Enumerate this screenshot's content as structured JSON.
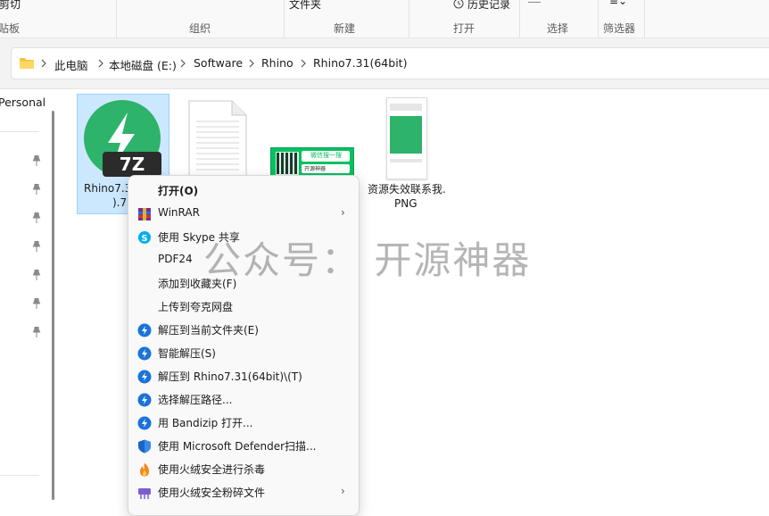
{
  "ribbon": {
    "cut_label": "剪切",
    "paste_label": "贴板",
    "new_folder_label": "文件夹",
    "history_label": "历史记录",
    "groups": {
      "organize": "组织",
      "new": "新建",
      "open": "打开",
      "select": "选择",
      "filter": "筛选器"
    }
  },
  "address": {
    "crumbs": [
      "此电脑",
      "本地磁盘 (E:)",
      "Software",
      "Rhino",
      "Rhino7.31(64bit)"
    ]
  },
  "nav": {
    "personal_label": "Personal"
  },
  "files": [
    {
      "name_line1": "Rhino7.3",
      "name_line2": ").7",
      "type": "7z-archive",
      "badge": "7Z",
      "selected": true
    },
    {
      "name": "",
      "type": "text-document"
    },
    {
      "name": "",
      "type": "wechat-qr-banner",
      "banner_text": "微信搜一搜",
      "banner_sub": "开源神器"
    },
    {
      "name_line1": "资源失效联系我.",
      "name_line2": "PNG",
      "type": "png-image"
    }
  ],
  "context_menu": {
    "items": [
      {
        "label": "打开(O)",
        "bold": true,
        "icon": "none",
        "submenu": false
      },
      {
        "label": "WinRAR",
        "icon": "winrar-icon",
        "submenu": true
      },
      {
        "label": "使用 Skype 共享",
        "icon": "skype-icon",
        "submenu": false
      },
      {
        "label": "PDF24",
        "icon": "none",
        "submenu": false
      },
      {
        "label": "添加到收藏夹(F)",
        "icon": "none",
        "submenu": false
      },
      {
        "label": "上传到夸克网盘",
        "icon": "none",
        "submenu": false
      },
      {
        "label": "解压到当前文件夹(E)",
        "icon": "bandizip-icon",
        "submenu": false
      },
      {
        "label": "智能解压(S)",
        "icon": "bandizip-icon",
        "submenu": false
      },
      {
        "label": "解压到 Rhino7.31(64bit)\\(T)",
        "icon": "bandizip-icon",
        "submenu": false
      },
      {
        "label": "选择解压路径...",
        "icon": "bandizip-icon",
        "submenu": false
      },
      {
        "label": "用 Bandizip 打开...",
        "icon": "bandizip-icon",
        "submenu": false
      },
      {
        "label": "使用 Microsoft Defender扫描...",
        "icon": "defender-icon",
        "submenu": false
      },
      {
        "label": "使用火绒安全进行杀毒",
        "icon": "huorong-icon",
        "submenu": false
      },
      {
        "label": "使用火绒安全粉碎文件",
        "icon": "huorong-shred-icon",
        "submenu": true
      }
    ]
  },
  "watermark": "公众号： 开源神器",
  "colors": {
    "selection": "#cce8ff",
    "selection_border": "#99d1ff",
    "bandizip_blue": "#1a73d9",
    "archive_green": "#2db36a",
    "wechat_green": "#07c160"
  }
}
